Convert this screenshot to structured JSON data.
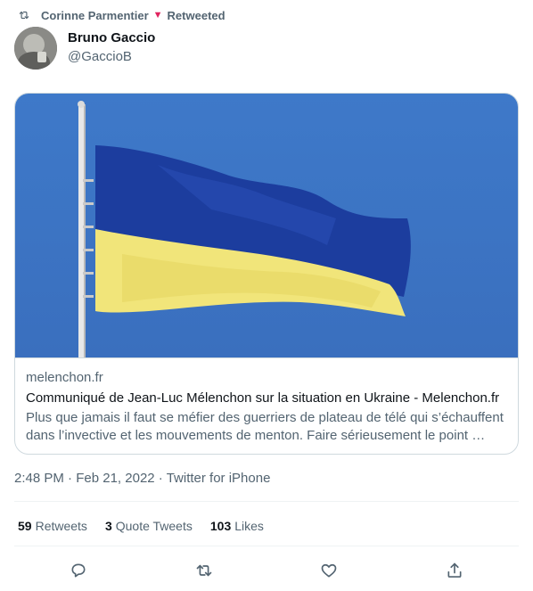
{
  "retweet_header": {
    "retweeter": "Corinne Parmentier",
    "action": "Retweeted",
    "icon": "retweet-icon"
  },
  "author": {
    "name": "Bruno Gaccio",
    "handle": "@GaccioB",
    "avatar": "avatar-photo"
  },
  "link_card": {
    "image": "ukraine-flag-photo",
    "domain": "melenchon.fr",
    "title": "Communiqué de Jean-Luc Mélenchon sur la situation en Ukraine - Melenchon.fr",
    "description": "Plus que jamais il faut se méfier des guerriers de plateau de télé qui s’échauffent dans l’invective et les mouvements de menton. Faire sérieusement le point …"
  },
  "meta": {
    "time": "2:48 PM",
    "date": "Feb 21, 2022",
    "source": "Twitter for iPhone"
  },
  "stats": [
    {
      "count": "59",
      "label": "Retweets"
    },
    {
      "count": "3",
      "label": "Quote Tweets"
    },
    {
      "count": "103",
      "label": "Likes"
    }
  ],
  "actions": [
    "reply-icon",
    "retweet-icon",
    "like-icon",
    "share-icon"
  ],
  "colors": {
    "secondary_text": "#536471",
    "primary_text": "#0f1419",
    "border": "#cfd9de",
    "flag_blue": "#1a3aa0",
    "flag_yellow": "#f3e87a",
    "sky": "#3b74c6"
  }
}
